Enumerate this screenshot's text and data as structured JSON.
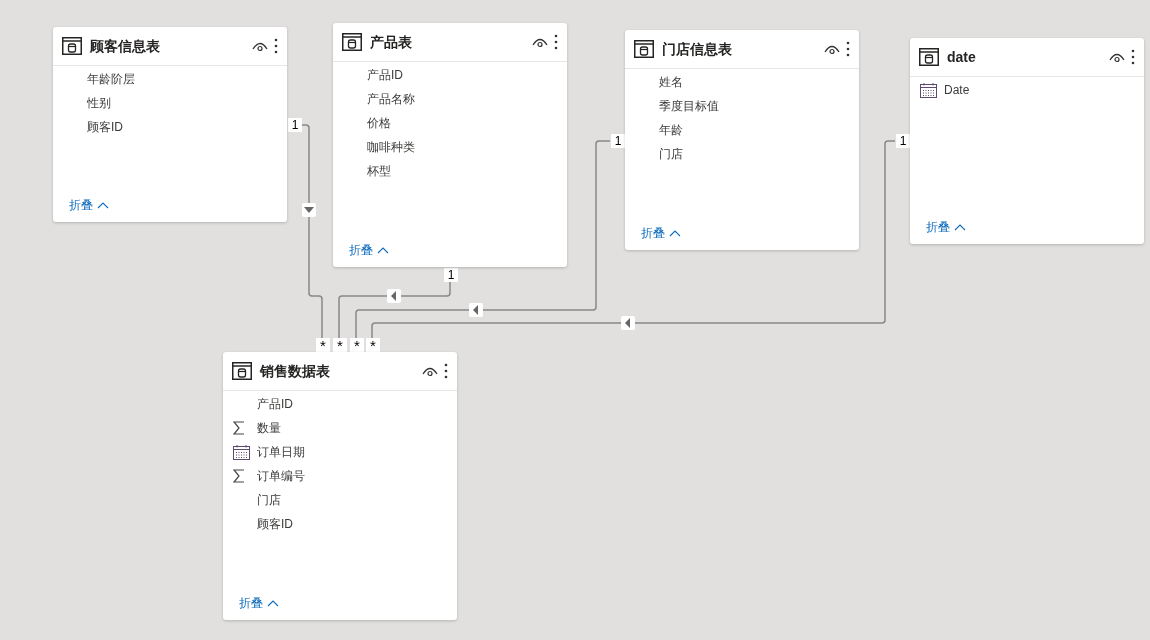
{
  "tables": [
    {
      "name": "顾客信息表",
      "fields": [
        {
          "name": "年龄阶层",
          "kind": "text"
        },
        {
          "name": "性别",
          "kind": "text"
        },
        {
          "name": "顾客ID",
          "kind": "text"
        }
      ],
      "collapse": "折叠"
    },
    {
      "name": "产品表",
      "fields": [
        {
          "name": "产品ID",
          "kind": "text"
        },
        {
          "name": "产品名称",
          "kind": "text"
        },
        {
          "name": "价格",
          "kind": "text"
        },
        {
          "name": "咖啡种类",
          "kind": "text"
        },
        {
          "name": "杯型",
          "kind": "text"
        }
      ],
      "collapse": "折叠"
    },
    {
      "name": "门店信息表",
      "fields": [
        {
          "name": "姓名",
          "kind": "text"
        },
        {
          "name": "季度目标值",
          "kind": "text"
        },
        {
          "name": "年龄",
          "kind": "text"
        },
        {
          "name": "门店",
          "kind": "text"
        }
      ],
      "collapse": "折叠"
    },
    {
      "name": "date",
      "fields": [
        {
          "name": "Date",
          "kind": "date"
        }
      ],
      "collapse": "折叠"
    },
    {
      "name": "销售数据表",
      "fields": [
        {
          "name": "产品ID",
          "kind": "text"
        },
        {
          "name": "数量",
          "kind": "sum"
        },
        {
          "name": "订单日期",
          "kind": "date"
        },
        {
          "name": "订单编号",
          "kind": "sum"
        },
        {
          "name": "门店",
          "kind": "text"
        },
        {
          "name": "顾客ID",
          "kind": "text"
        }
      ],
      "collapse": "折叠"
    }
  ],
  "relationships": [
    {
      "one": "1",
      "many": "*"
    },
    {
      "one": "1",
      "many": "*"
    },
    {
      "one": "1",
      "many": "*"
    },
    {
      "one": "1",
      "many": "*"
    }
  ]
}
